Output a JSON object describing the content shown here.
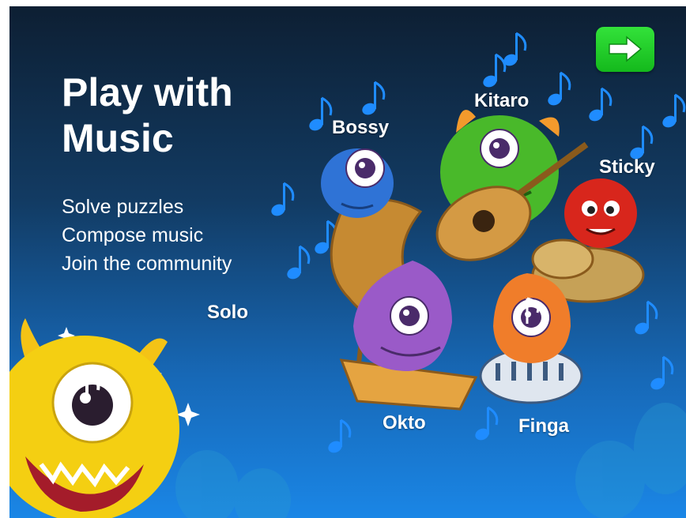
{
  "intro": {
    "title_line1": "Play with",
    "title_line2": "Music",
    "features": [
      "Solve puzzles",
      "Compose music",
      "Join the community"
    ]
  },
  "characters": {
    "solo": "Solo",
    "bossy": "Bossy",
    "kitaro": "Kitaro",
    "sticky": "Sticky",
    "okto": "Okto",
    "finga": "Finga"
  },
  "next_button": {
    "icon": "arrow-right-icon"
  },
  "colors": {
    "background_top": "#0d1f33",
    "background_bottom": "#1a86e6",
    "note": "#1f8cff",
    "next_button": "#1ec928",
    "solo": "#f4cf12",
    "bossy": "#2f73d6",
    "kitaro": "#49b92a",
    "sticky": "#d8261c",
    "okto": "#9a5ac8",
    "finga": "#f07d2a"
  }
}
